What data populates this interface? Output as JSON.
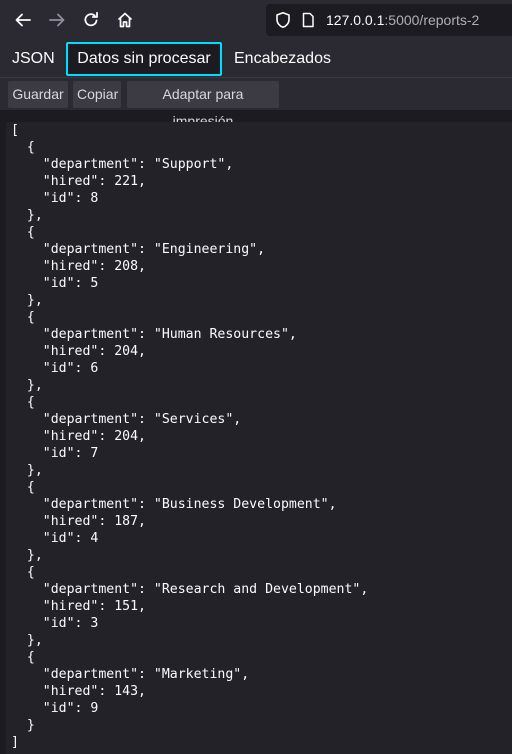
{
  "browser": {
    "back_icon": "arrow-left-icon",
    "forward_icon": "arrow-right-icon",
    "reload_icon": "reload-icon",
    "home_icon": "home-icon",
    "url_host": "127.0.0.1",
    "url_rest": ":5000/reports-2"
  },
  "tabs": {
    "json": "JSON",
    "raw": "Datos sin procesar",
    "headers": "Encabezados"
  },
  "toolbar": {
    "save": "Guardar",
    "copy": "Copiar",
    "print": "Adaptar para impresión"
  },
  "raw_text": "[\n  {\n    \"department\": \"Support\",\n    \"hired\": 221,\n    \"id\": 8\n  },\n  {\n    \"department\": \"Engineering\",\n    \"hired\": 208,\n    \"id\": 5\n  },\n  {\n    \"department\": \"Human Resources\",\n    \"hired\": 204,\n    \"id\": 6\n  },\n  {\n    \"department\": \"Services\",\n    \"hired\": 204,\n    \"id\": 7\n  },\n  {\n    \"department\": \"Business Development\",\n    \"hired\": 187,\n    \"id\": 4\n  },\n  {\n    \"department\": \"Research and Development\",\n    \"hired\": 151,\n    \"id\": 3\n  },\n  {\n    \"department\": \"Marketing\",\n    \"hired\": 143,\n    \"id\": 9\n  }\n]"
}
